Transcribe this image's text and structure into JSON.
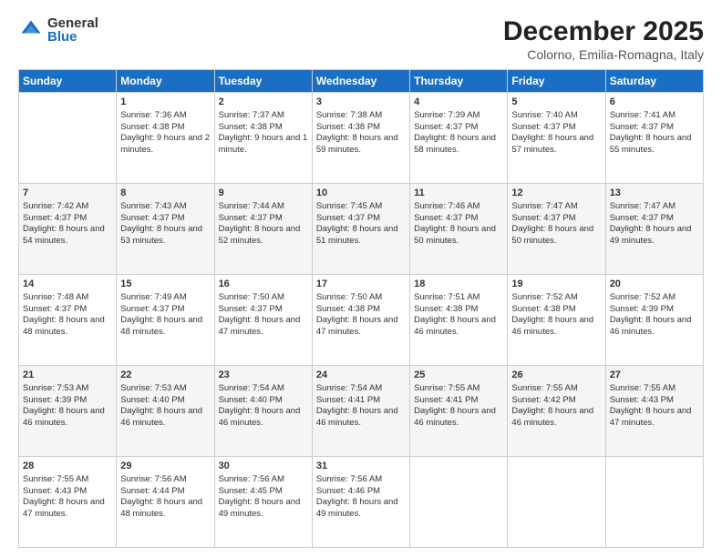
{
  "logo": {
    "general": "General",
    "blue": "Blue"
  },
  "title": "December 2025",
  "location": "Colorno, Emilia-Romagna, Italy",
  "days_header": [
    "Sunday",
    "Monday",
    "Tuesday",
    "Wednesday",
    "Thursday",
    "Friday",
    "Saturday"
  ],
  "weeks": [
    [
      {
        "num": "",
        "sunrise": "",
        "sunset": "",
        "daylight": ""
      },
      {
        "num": "1",
        "sunrise": "Sunrise: 7:36 AM",
        "sunset": "Sunset: 4:38 PM",
        "daylight": "Daylight: 9 hours and 2 minutes."
      },
      {
        "num": "2",
        "sunrise": "Sunrise: 7:37 AM",
        "sunset": "Sunset: 4:38 PM",
        "daylight": "Daylight: 9 hours and 1 minute."
      },
      {
        "num": "3",
        "sunrise": "Sunrise: 7:38 AM",
        "sunset": "Sunset: 4:38 PM",
        "daylight": "Daylight: 8 hours and 59 minutes."
      },
      {
        "num": "4",
        "sunrise": "Sunrise: 7:39 AM",
        "sunset": "Sunset: 4:37 PM",
        "daylight": "Daylight: 8 hours and 58 minutes."
      },
      {
        "num": "5",
        "sunrise": "Sunrise: 7:40 AM",
        "sunset": "Sunset: 4:37 PM",
        "daylight": "Daylight: 8 hours and 57 minutes."
      },
      {
        "num": "6",
        "sunrise": "Sunrise: 7:41 AM",
        "sunset": "Sunset: 4:37 PM",
        "daylight": "Daylight: 8 hours and 55 minutes."
      }
    ],
    [
      {
        "num": "7",
        "sunrise": "Sunrise: 7:42 AM",
        "sunset": "Sunset: 4:37 PM",
        "daylight": "Daylight: 8 hours and 54 minutes."
      },
      {
        "num": "8",
        "sunrise": "Sunrise: 7:43 AM",
        "sunset": "Sunset: 4:37 PM",
        "daylight": "Daylight: 8 hours and 53 minutes."
      },
      {
        "num": "9",
        "sunrise": "Sunrise: 7:44 AM",
        "sunset": "Sunset: 4:37 PM",
        "daylight": "Daylight: 8 hours and 52 minutes."
      },
      {
        "num": "10",
        "sunrise": "Sunrise: 7:45 AM",
        "sunset": "Sunset: 4:37 PM",
        "daylight": "Daylight: 8 hours and 51 minutes."
      },
      {
        "num": "11",
        "sunrise": "Sunrise: 7:46 AM",
        "sunset": "Sunset: 4:37 PM",
        "daylight": "Daylight: 8 hours and 50 minutes."
      },
      {
        "num": "12",
        "sunrise": "Sunrise: 7:47 AM",
        "sunset": "Sunset: 4:37 PM",
        "daylight": "Daylight: 8 hours and 50 minutes."
      },
      {
        "num": "13",
        "sunrise": "Sunrise: 7:47 AM",
        "sunset": "Sunset: 4:37 PM",
        "daylight": "Daylight: 8 hours and 49 minutes."
      }
    ],
    [
      {
        "num": "14",
        "sunrise": "Sunrise: 7:48 AM",
        "sunset": "Sunset: 4:37 PM",
        "daylight": "Daylight: 8 hours and 48 minutes."
      },
      {
        "num": "15",
        "sunrise": "Sunrise: 7:49 AM",
        "sunset": "Sunset: 4:37 PM",
        "daylight": "Daylight: 8 hours and 48 minutes."
      },
      {
        "num": "16",
        "sunrise": "Sunrise: 7:50 AM",
        "sunset": "Sunset: 4:37 PM",
        "daylight": "Daylight: 8 hours and 47 minutes."
      },
      {
        "num": "17",
        "sunrise": "Sunrise: 7:50 AM",
        "sunset": "Sunset: 4:38 PM",
        "daylight": "Daylight: 8 hours and 47 minutes."
      },
      {
        "num": "18",
        "sunrise": "Sunrise: 7:51 AM",
        "sunset": "Sunset: 4:38 PM",
        "daylight": "Daylight: 8 hours and 46 minutes."
      },
      {
        "num": "19",
        "sunrise": "Sunrise: 7:52 AM",
        "sunset": "Sunset: 4:38 PM",
        "daylight": "Daylight: 8 hours and 46 minutes."
      },
      {
        "num": "20",
        "sunrise": "Sunrise: 7:52 AM",
        "sunset": "Sunset: 4:39 PM",
        "daylight": "Daylight: 8 hours and 46 minutes."
      }
    ],
    [
      {
        "num": "21",
        "sunrise": "Sunrise: 7:53 AM",
        "sunset": "Sunset: 4:39 PM",
        "daylight": "Daylight: 8 hours and 46 minutes."
      },
      {
        "num": "22",
        "sunrise": "Sunrise: 7:53 AM",
        "sunset": "Sunset: 4:40 PM",
        "daylight": "Daylight: 8 hours and 46 minutes."
      },
      {
        "num": "23",
        "sunrise": "Sunrise: 7:54 AM",
        "sunset": "Sunset: 4:40 PM",
        "daylight": "Daylight: 8 hours and 46 minutes."
      },
      {
        "num": "24",
        "sunrise": "Sunrise: 7:54 AM",
        "sunset": "Sunset: 4:41 PM",
        "daylight": "Daylight: 8 hours and 46 minutes."
      },
      {
        "num": "25",
        "sunrise": "Sunrise: 7:55 AM",
        "sunset": "Sunset: 4:41 PM",
        "daylight": "Daylight: 8 hours and 46 minutes."
      },
      {
        "num": "26",
        "sunrise": "Sunrise: 7:55 AM",
        "sunset": "Sunset: 4:42 PM",
        "daylight": "Daylight: 8 hours and 46 minutes."
      },
      {
        "num": "27",
        "sunrise": "Sunrise: 7:55 AM",
        "sunset": "Sunset: 4:43 PM",
        "daylight": "Daylight: 8 hours and 47 minutes."
      }
    ],
    [
      {
        "num": "28",
        "sunrise": "Sunrise: 7:55 AM",
        "sunset": "Sunset: 4:43 PM",
        "daylight": "Daylight: 8 hours and 47 minutes."
      },
      {
        "num": "29",
        "sunrise": "Sunrise: 7:56 AM",
        "sunset": "Sunset: 4:44 PM",
        "daylight": "Daylight: 8 hours and 48 minutes."
      },
      {
        "num": "30",
        "sunrise": "Sunrise: 7:56 AM",
        "sunset": "Sunset: 4:45 PM",
        "daylight": "Daylight: 8 hours and 49 minutes."
      },
      {
        "num": "31",
        "sunrise": "Sunrise: 7:56 AM",
        "sunset": "Sunset: 4:46 PM",
        "daylight": "Daylight: 8 hours and 49 minutes."
      },
      {
        "num": "",
        "sunrise": "",
        "sunset": "",
        "daylight": ""
      },
      {
        "num": "",
        "sunrise": "",
        "sunset": "",
        "daylight": ""
      },
      {
        "num": "",
        "sunrise": "",
        "sunset": "",
        "daylight": ""
      }
    ]
  ]
}
